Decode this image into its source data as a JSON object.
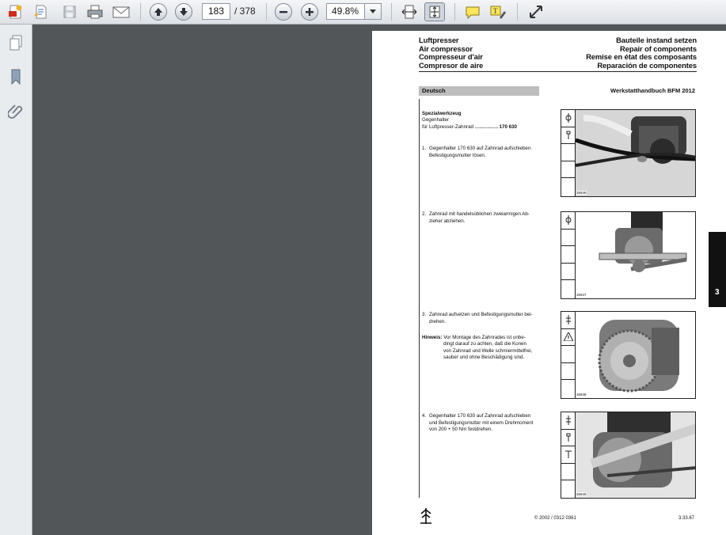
{
  "toolbar": {
    "page_current": "183",
    "page_total": "/ 378",
    "zoom_value": "49.8%",
    "icons": [
      "create-pdf-icon",
      "edit-icon",
      "save-icon",
      "print-icon",
      "email-icon",
      "previous-page-icon",
      "next-page-icon",
      "zoom-out-icon",
      "zoom-in-icon",
      "zoom-dropdown-icon",
      "fit-width-icon",
      "fit-page-icon",
      "comment-icon",
      "highlight-text-icon",
      "fullscreen-icon"
    ]
  },
  "leftnav": {
    "icons": [
      "pages-icon",
      "bookmarks-icon",
      "attachments-icon"
    ]
  },
  "document": {
    "header_left": [
      "Luftpresser",
      "Air compressor",
      "Compresseur d'air",
      "Compresor de aire"
    ],
    "header_right": [
      "Bauteile instand setzen",
      "Repair of components",
      "Remise en état des composants",
      "Reparación de componentes"
    ],
    "language": "Deutsch",
    "handbook": "Werkstatthandbuch BFM 2012",
    "tools_title": "Spezialwerkzeug",
    "tools_line1": "Gegenhalter",
    "tools_line2_label": "für Luftpresser-Zahnrad",
    "tools_line2_dots": "..........................",
    "tools_line2_num": "170 630",
    "steps": [
      {
        "num": "1.",
        "line1": "Gegenhalter 170 630 auf Zahnrad aufschieben.",
        "line2": "Befestigungsmutter lösen."
      },
      {
        "num": "2.",
        "line1": "Zahnrad mit handelsüblichen zweiarmigen Ab-",
        "line2": "zieher abziehen."
      },
      {
        "num": "3.",
        "line1": "Zahnrad aufsetzen und Befestigungsmutter bei-",
        "line2": "drehen."
      },
      {
        "num": "4.",
        "line1": "Gegenhalter 170 630 auf Zahnrad aufschieben",
        "line2": "und Befestigungsmutter mit einem Drehmoment",
        "line3": "von 200 + 50 Nm festdrehen."
      }
    ],
    "note_label": "Hinweis:",
    "note_lines": [
      "Vor Montage des Zahnrades ist unbe-",
      "dingt darauf zu achten, daß die Konen",
      "von Zahnrad und Welle schmiermittelfrei,",
      "sauber und ohne Beschädigung sind."
    ],
    "photo_numbers": [
      "36946",
      "36947",
      "36948",
      "36949"
    ],
    "tab_number": "3",
    "footer_copyright": "© 2002 / 0312 0361",
    "footer_page": "3.33.67"
  }
}
